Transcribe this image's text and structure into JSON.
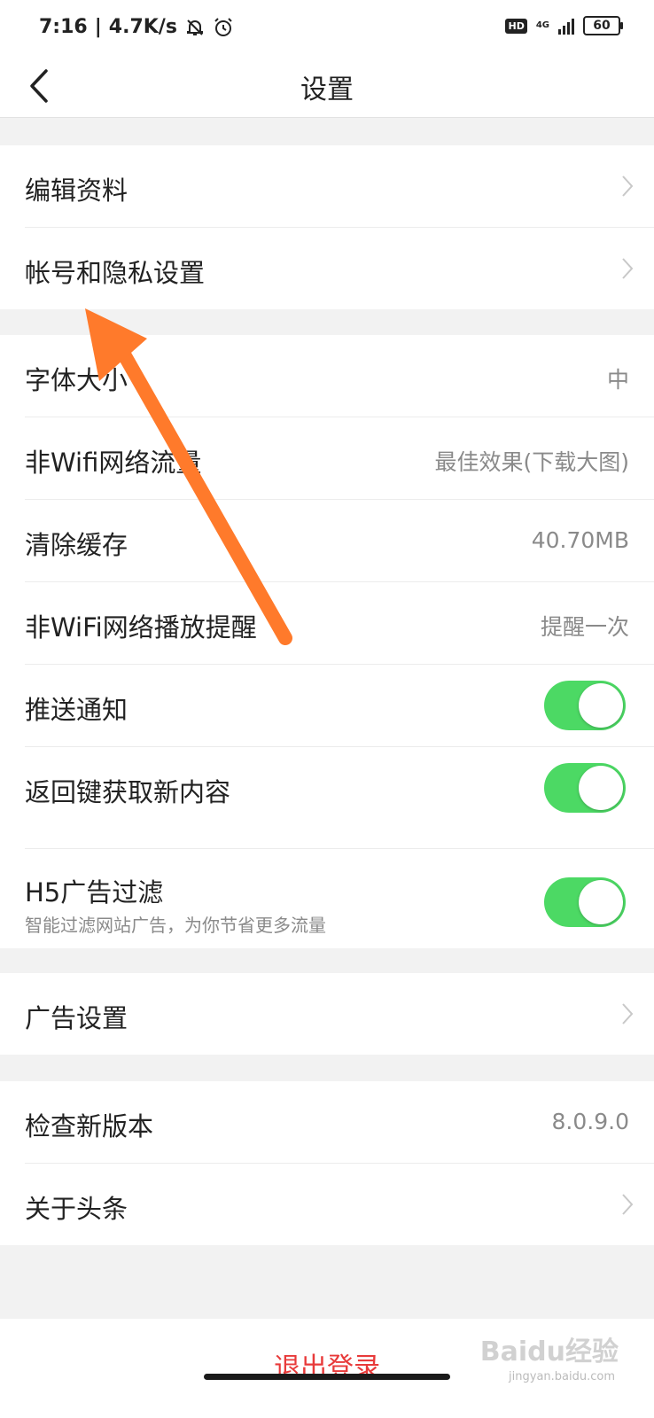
{
  "status_bar": {
    "time": "7:16",
    "speed": "4.7K/s",
    "network": "4G",
    "hd": "HD",
    "battery": "60"
  },
  "header": {
    "title": "设置"
  },
  "group1": [
    {
      "label": "编辑资料"
    },
    {
      "label": "帐号和隐私设置"
    }
  ],
  "group2": {
    "font_size": {
      "label": "字体大小",
      "value": "中"
    },
    "non_wifi_traffic": {
      "label": "非Wifi网络流量",
      "value": "最佳效果(下载大图)"
    },
    "clear_cache": {
      "label": "清除缓存",
      "value": "40.70MB"
    },
    "non_wifi_play": {
      "label": "非WiFi网络播放提醒",
      "value": "提醒一次"
    },
    "push": {
      "label": "推送通知",
      "on": true
    },
    "back_refresh": {
      "label": "返回键获取新内容",
      "on": true
    },
    "h5_filter": {
      "label": "H5广告过滤",
      "sub": "智能过滤网站广告，为你节省更多流量",
      "on": true
    }
  },
  "group3": [
    {
      "label": "广告设置"
    }
  ],
  "group4": {
    "check_version": {
      "label": "检查新版本",
      "value": "8.0.9.0"
    },
    "about": {
      "label": "关于头条"
    }
  },
  "logout": {
    "label": "退出登录"
  },
  "watermark": {
    "text": "Baidu经验",
    "sub": "jingyan.baidu.com"
  },
  "colors": {
    "toggle_on": "#4cd964",
    "arrow": "#ff7a2b",
    "logout": "#e83a3a"
  }
}
